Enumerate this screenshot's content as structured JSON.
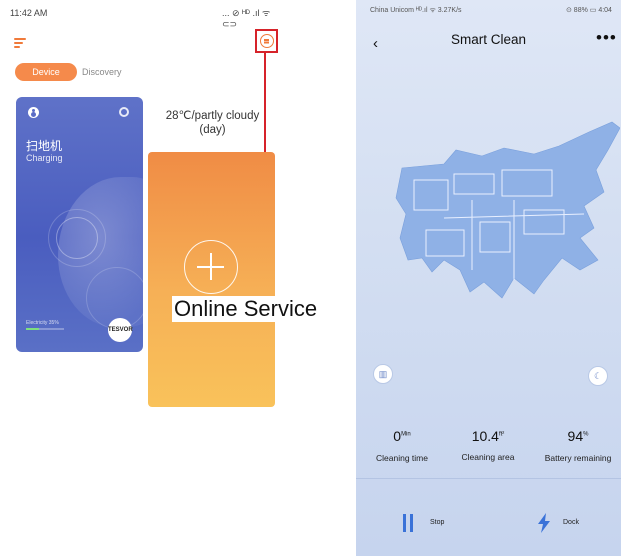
{
  "left_phone": {
    "status_time": "11:42 AM",
    "status_icons": "... ⊘ ᴴᴰ .ıl ᯤ ⊂⊃",
    "tabs": [
      {
        "label": "Device",
        "active": true
      },
      {
        "label": "Discovery",
        "active": false
      }
    ],
    "device_card": {
      "name": "扫地机",
      "status": "Charging",
      "electricity_label": "Electricity 35%",
      "electricity_level": 0.35,
      "brand": "TESVOR"
    },
    "weather": {
      "line1": "28℃/partly cloudy",
      "line2": "(day)"
    },
    "callout_label": "Online Service",
    "colors": {
      "accent": "#f07a3a",
      "highlight": "#d6232a",
      "card_blue": "#5166c4",
      "card_orange": "#f5a350"
    }
  },
  "right_phone": {
    "status_left": "China Unicom ᴴᴰ.ıl ᯤ 3.27K/s",
    "status_right": "⊙ 88% ▭ 4:04",
    "back_glyph": "‹",
    "title": "Smart Clean",
    "more_glyph": "•••",
    "stats": [
      {
        "value": "0",
        "unit": "Min",
        "label": "Cleaning time"
      },
      {
        "value": "10.4",
        "unit": "ft²",
        "label": "Cleaning area"
      },
      {
        "value": "94",
        "unit": "%",
        "label": "Battery remaining"
      }
    ],
    "controls": {
      "stop_label": "Stop",
      "dock_label": "Dock"
    },
    "icons": {
      "map": "map-icon",
      "moon": "moon-icon"
    },
    "colors": {
      "map_blue": "#8fb1e6",
      "button_blue": "#3a72d8"
    }
  }
}
